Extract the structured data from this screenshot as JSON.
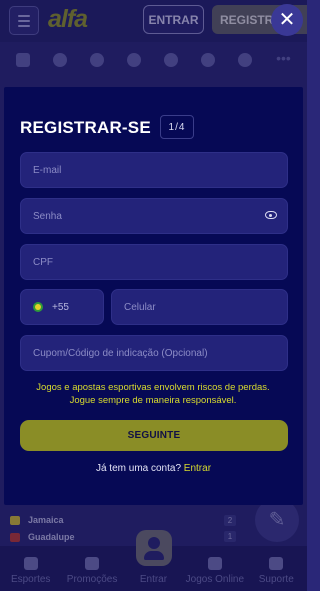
{
  "header": {
    "logo_text": "alfa",
    "login_label": "ENTRAR",
    "register_label": "REGISTRAR",
    "close_icon": "close-icon",
    "menu_icon": "hamburger-icon"
  },
  "sports_bar": {
    "icons": [
      "esports-icon",
      "soccer-icon",
      "basketball-icon",
      "tennis-icon",
      "football-icon",
      "baseball-icon",
      "volleyball-icon",
      "more-icon"
    ]
  },
  "background_matches": [
    {
      "team": "Jamaica",
      "score": "2"
    },
    {
      "team": "Guadalupe",
      "score": "1"
    }
  ],
  "bottom_nav": {
    "items": [
      {
        "label": "Esportes",
        "icon": "trophy-icon"
      },
      {
        "label": "Promoções",
        "icon": "gift-icon"
      },
      {
        "label": "Entrar",
        "icon": "user-icon"
      },
      {
        "label": "Jogos Online",
        "icon": "spade-icon"
      },
      {
        "label": "Suporte",
        "icon": "headset-icon"
      }
    ]
  },
  "modal": {
    "title": "REGISTRAR-SE",
    "step": "1/4",
    "email_placeholder": "E-mail",
    "password_placeholder": "Senha",
    "cpf_placeholder": "CPF",
    "country_code": "+55",
    "phone_placeholder": "Celular",
    "promo_placeholder": "Cupom/Código de indicação (Opcional)",
    "warning_line1": "Jogos e apostas esportivas envolvem riscos de perdas.",
    "warning_line2": "Jogue sempre de maneira responsável.",
    "next_label": "SEGUINTE",
    "has_account_text": "Já tem uma conta?",
    "login_link": "Entrar"
  },
  "colors": {
    "modal_bg": "#060955",
    "accent_yellow": "#d8db2e",
    "button_olive": "#8a8d26",
    "field_bg": "#23237a"
  }
}
